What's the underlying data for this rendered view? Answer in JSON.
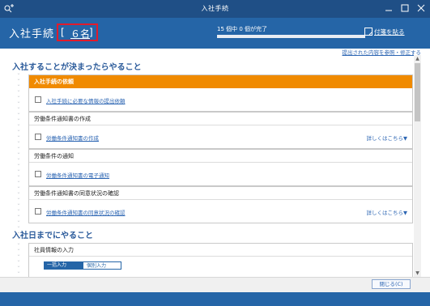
{
  "window": {
    "title": "入社手続",
    "app_icon": "search-plus-icon",
    "controls": [
      "minimize-icon",
      "maximize-icon",
      "close-icon"
    ]
  },
  "header": {
    "title": "入社手続",
    "count_open": "[",
    "count_value": "６名",
    "count_close": "]",
    "progress_text": "15 個中 0 個が完了",
    "progress_fraction": 0,
    "memo_label": "付箋を貼る",
    "memo_icon": "sticky-note-icon"
  },
  "toplink": "提出された内容を参照・修正する",
  "sections": [
    {
      "title": "入社することが決まったらやること",
      "cards": [
        {
          "heading": "入社手続の依頼",
          "highlight": true,
          "item": "入社手続に必要な情報の提出依頼",
          "more": ""
        },
        {
          "heading": "労働条件通知書の作成",
          "highlight": false,
          "item": "労働条件通知書の作成",
          "more": "詳しくはこちら▼"
        },
        {
          "heading": "労働条件の通知",
          "highlight": false,
          "item": "労働条件通知書の電子通知",
          "more": ""
        },
        {
          "heading": "労働条件通知書の同意状況の確認",
          "highlight": false,
          "item": "労働条件通知書の同意状況の確認",
          "more": "詳しくはこちら▼"
        }
      ]
    },
    {
      "title": "入社日までにやること",
      "cards": [
        {
          "heading": "社員情報の入力",
          "highlight": false,
          "tabs": [
            "一括入力",
            "個別入力"
          ]
        }
      ]
    }
  ],
  "footer": {
    "close_label": "閉じる(C)"
  },
  "colors": {
    "titlebar": "#1f4f86",
    "header": "#2565a7",
    "accent_orange": "#f08a00",
    "link_blue": "#2d66b3",
    "count_border": "#e21b2b",
    "progress": "#8fd14f"
  }
}
